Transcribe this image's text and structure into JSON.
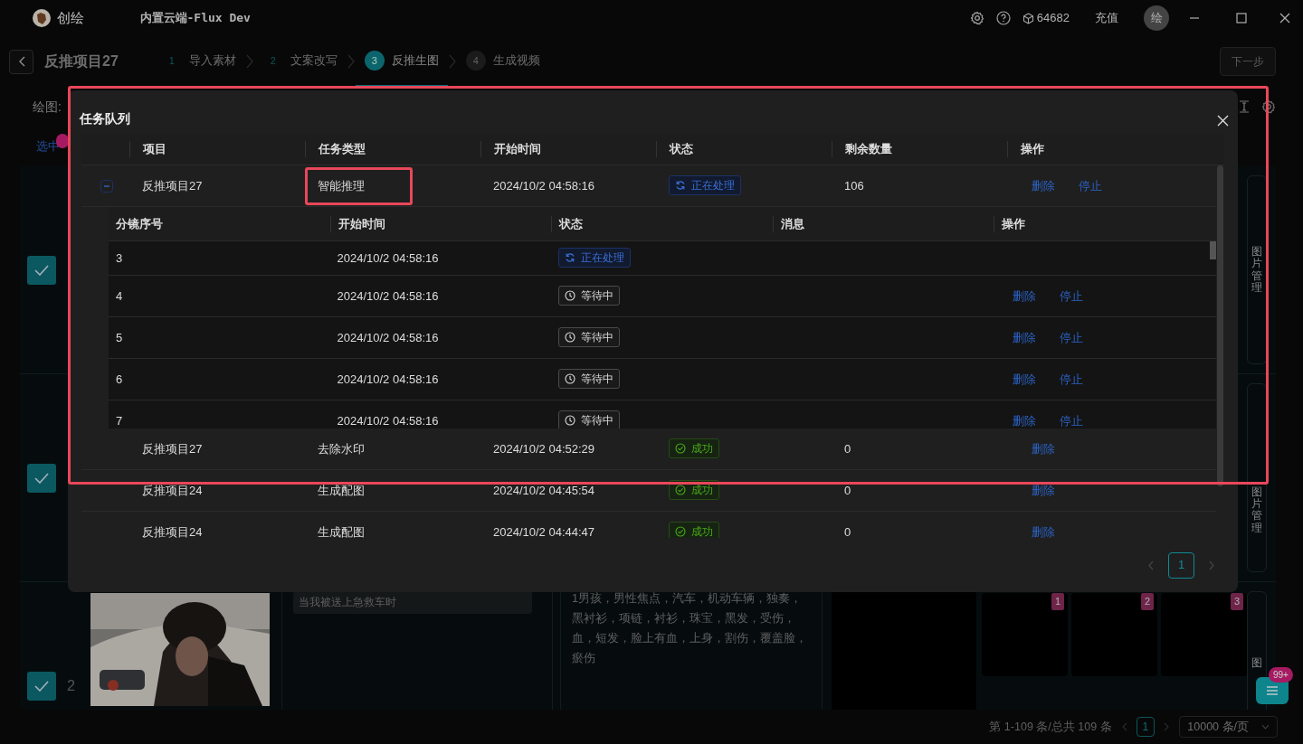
{
  "app": {
    "name": "创绘",
    "model": "内置云端-Flux Dev",
    "credits": "64682",
    "recharge": "充值",
    "avatar": "绘"
  },
  "header": {
    "project": "反推项目27",
    "steps": [
      {
        "number": "1",
        "label": "导入素材",
        "done": true,
        "selected": false
      },
      {
        "number": "2",
        "label": "文案改写",
        "done": true,
        "selected": false
      },
      {
        "number": "3",
        "label": "反推生图",
        "done": false,
        "selected": true
      },
      {
        "number": "4",
        "label": "生成视频",
        "done": false,
        "selected": false
      }
    ],
    "next_button": {
      "label": "下一步",
      "disabled": true
    }
  },
  "toolbar": {
    "label": "绘图:"
  },
  "list": {
    "select_label": "选中",
    "rows": [
      {
        "checked": true,
        "side_tab": "图片管理"
      },
      {
        "checked": true,
        "side_tab": "图片管理"
      },
      {
        "checked": true,
        "number": "2",
        "caption": "当我被送上急救车时",
        "prompt": "1男孩，男性焦点，汽车，机动车辆，独奏，黑衬衫，项链，衬衫，珠宝，黑发，受伤，血，短发，脸上有血，上身，割伤，覆盖脸，瘀伤",
        "thumbnails": [
          "1",
          "2",
          "3"
        ],
        "side_tab": "图"
      }
    ]
  },
  "footer": {
    "summary": "第 1-109 条/总共 109 条",
    "page": "1",
    "page_size": "10000 条/页"
  },
  "float_button": {
    "badge": "99+"
  },
  "modal": {
    "title": "任务队列",
    "highlighted": true,
    "columns": [
      "项目",
      "任务类型",
      "开始时间",
      "状态",
      "剩余数量",
      "操作"
    ],
    "tasks": [
      {
        "project": "反推项目27",
        "type": "智能推理",
        "start": "2024/10/2 04:58:16",
        "status": {
          "kind": "processing",
          "label": "正在处理"
        },
        "remaining": "106",
        "actions": [
          "删除",
          "停止"
        ],
        "expanded": true,
        "type_highlighted": true,
        "subtasks": {
          "columns": [
            "分镜序号",
            "开始时间",
            "状态",
            "消息",
            "操作"
          ],
          "rows": [
            {
              "index": "3",
              "start": "2024/10/2 04:58:16",
              "status": {
                "kind": "processing",
                "label": "正在处理"
              },
              "actions": []
            },
            {
              "index": "4",
              "start": "2024/10/2 04:58:16",
              "status": {
                "kind": "waiting",
                "label": "等待中"
              },
              "actions": [
                "删除",
                "停止"
              ]
            },
            {
              "index": "5",
              "start": "2024/10/2 04:58:16",
              "status": {
                "kind": "waiting",
                "label": "等待中"
              },
              "actions": [
                "删除",
                "停止"
              ]
            },
            {
              "index": "6",
              "start": "2024/10/2 04:58:16",
              "status": {
                "kind": "waiting",
                "label": "等待中"
              },
              "actions": [
                "删除",
                "停止"
              ]
            },
            {
              "index": "7",
              "start": "2024/10/2 04:58:16",
              "status": {
                "kind": "waiting",
                "label": "等待中"
              },
              "actions": [
                "删除",
                "停止"
              ]
            }
          ]
        }
      },
      {
        "project": "反推项目27",
        "type": "去除水印",
        "start": "2024/10/2 04:52:29",
        "status": {
          "kind": "success",
          "label": "成功"
        },
        "remaining": "0",
        "actions": [
          "删除"
        ]
      },
      {
        "project": "反推项目24",
        "type": "生成配图",
        "start": "2024/10/2 04:45:54",
        "status": {
          "kind": "success",
          "label": "成功"
        },
        "remaining": "0",
        "actions": [
          "删除"
        ]
      },
      {
        "project": "反推项目24",
        "type": "生成配图",
        "start": "2024/10/2 04:44:47",
        "status": {
          "kind": "success",
          "label": "成功"
        },
        "remaining": "0",
        "actions": [
          "删除"
        ]
      }
    ],
    "pagination": {
      "page": "1"
    }
  }
}
